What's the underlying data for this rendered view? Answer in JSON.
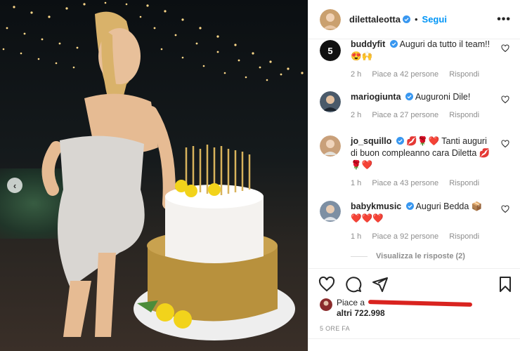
{
  "post": {
    "author": "dilettaleotta",
    "follow_label": "Segui",
    "more_label": "•••",
    "separator": "•"
  },
  "comments": [
    {
      "user": "buddyfit",
      "verified": true,
      "text": "Auguri da tutto il team!! 😍🙌",
      "time": "2 h",
      "likes": "Piace a 42 persone",
      "reply": "Rispondi",
      "avatar_color": "#111111"
    },
    {
      "user": "mariogiunta",
      "verified": true,
      "text": "Auguroni Dile!",
      "time": "2 h",
      "likes": "Piace a 27 persone",
      "reply": "Rispondi",
      "avatar_color": "#4a5a6a"
    },
    {
      "user": "jo_squillo",
      "verified": true,
      "text": "💋🌹❤️ Tanti auguri di buon compleanno cara Diletta 💋🌹❤️",
      "time": "1 h",
      "likes": "Piace a 43 persone",
      "reply": "Rispondi",
      "avatar_color": "#c9a07a"
    },
    {
      "user": "babykmusic",
      "verified": true,
      "text": "Auguri Bedda 📦 ❤️❤️❤️",
      "time": "1 h",
      "likes": "Piace a 92 persone",
      "reply": "Rispondi",
      "avatar_color": "#7d8fa3"
    }
  ],
  "view_replies": "Visualizza le risposte (2)",
  "likes_summary": {
    "prefix": "Piace a",
    "suffix": "altri 722.998"
  },
  "timestamp": "5 ORE FA",
  "colors": {
    "accent": "#0095f6",
    "verified": "#3897f0",
    "redaction": "#d9231f"
  }
}
